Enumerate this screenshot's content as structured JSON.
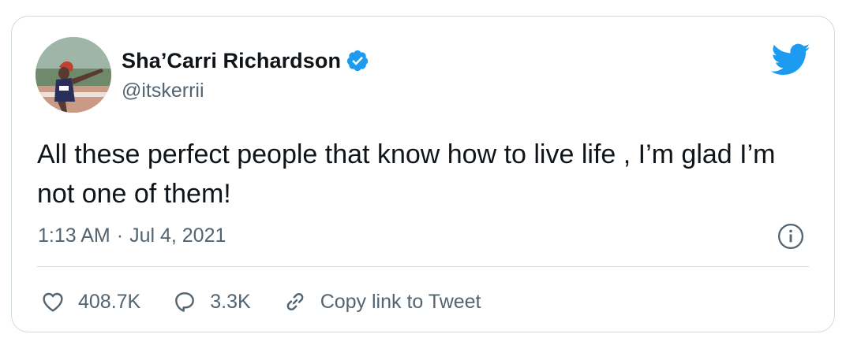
{
  "tweet": {
    "author": {
      "name": "Sha’Carri Richardson",
      "handle": "@itskerrii",
      "verified": true,
      "avatar_icon": "profile-photo"
    },
    "text": "All these perfect people that know how to live life , I’m glad I’m not one of them!",
    "time": "1:13 AM",
    "separator": "·",
    "date": "Jul 4, 2021",
    "actions": {
      "like_count": "408.7K",
      "reply_count": "3.3K",
      "copy_link_label": "Copy link to Tweet"
    },
    "icons": {
      "brand": "twitter-bird-icon",
      "verified": "verified-badge-icon",
      "info": "info-icon",
      "like": "heart-icon",
      "reply": "speech-bubble-icon",
      "link": "link-icon"
    },
    "colors": {
      "brand_blue": "#1d9bf0",
      "text_primary": "#0f1419",
      "text_secondary": "#536471",
      "border": "#cfd9de"
    }
  }
}
